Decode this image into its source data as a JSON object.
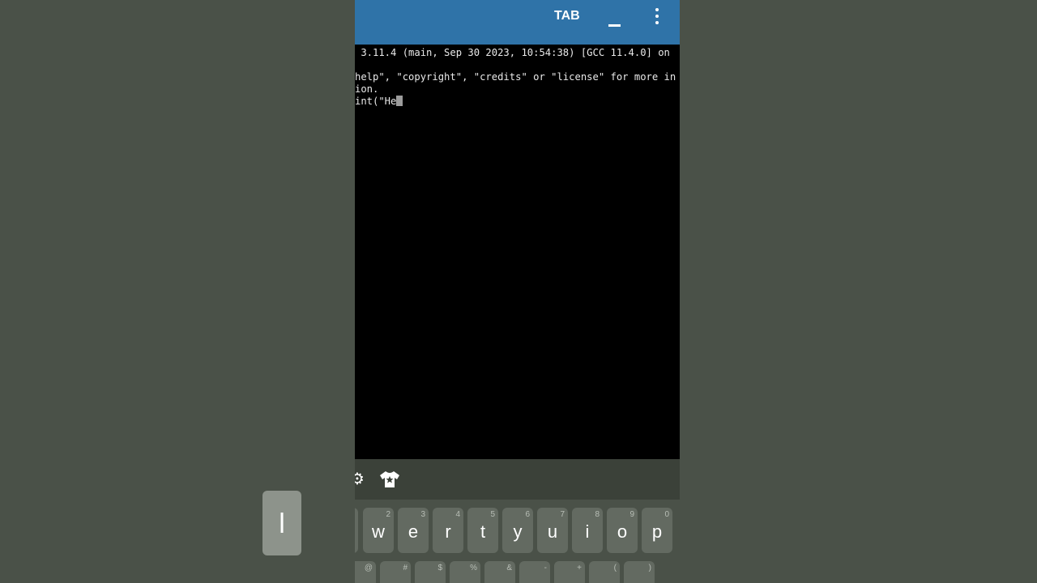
{
  "app_bar": {
    "tab_label": "TAB",
    "minimize_icon": "minimize-icon",
    "more_icon": "more-vert-icon",
    "color": "#2f73a8"
  },
  "terminal": {
    "lines": [
      " 3.11.4 (main, Sep 30 2023, 10:54:38) [GCC 11.4.0] on",
      "help\", \"copyright\", \"credits\" or \"license\" for more in",
      "ion.",
      "int(\"He"
    ]
  },
  "suggestion_bar": {
    "icons": [
      "settings-icon",
      "shirt-theme-icon"
    ]
  },
  "keyboard": {
    "popup_key": "l",
    "row1": [
      {
        "label": "w",
        "hint": "2"
      },
      {
        "label": "e",
        "hint": "3"
      },
      {
        "label": "r",
        "hint": "4"
      },
      {
        "label": "t",
        "hint": "5"
      },
      {
        "label": "y",
        "hint": "6"
      },
      {
        "label": "u",
        "hint": "7"
      },
      {
        "label": "i",
        "hint": "8"
      },
      {
        "label": "o",
        "hint": "9"
      },
      {
        "label": "p",
        "hint": "0"
      }
    ],
    "row2_hints": [
      "@",
      "#",
      "$",
      "%",
      "&",
      "-",
      "+",
      "(",
      ")"
    ]
  }
}
